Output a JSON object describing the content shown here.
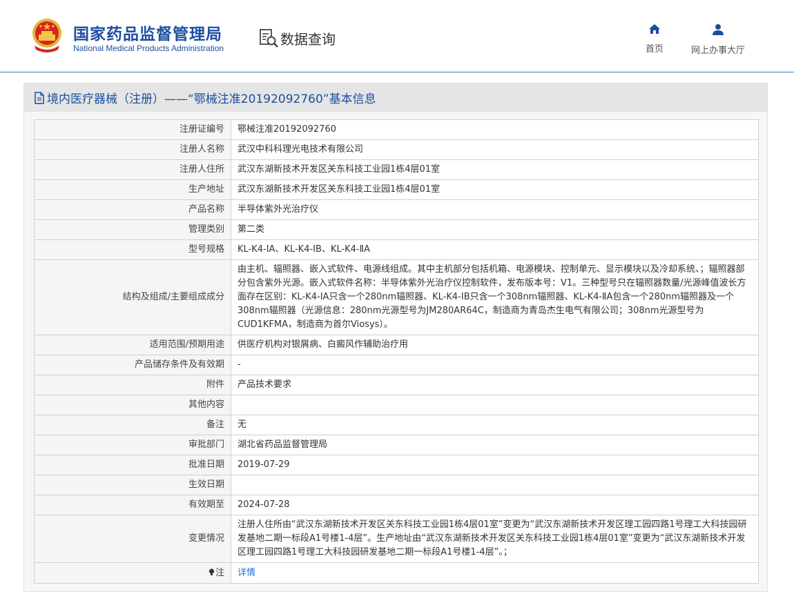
{
  "header": {
    "brand_cn": "国家药品监督管理局",
    "brand_en": "National Medical Products Administration",
    "module_title": "数据查询",
    "nav": [
      {
        "label": "首页",
        "icon": "home-icon"
      },
      {
        "label": "网上办事大厅",
        "icon": "user-icon"
      }
    ],
    "accent_color": "#1d4ea0"
  },
  "panel": {
    "title": "境内医疗器械（注册）——“鄂械注准20192092760”基本信息"
  },
  "rows": [
    {
      "label": "注册证编号",
      "value": "鄂械注准20192092760"
    },
    {
      "label": "注册人名称",
      "value": "武汉中科科理光电技术有限公司"
    },
    {
      "label": "注册人住所",
      "value": "武汉东湖新技术开发区关东科技工业园1栋4层01室"
    },
    {
      "label": "生产地址",
      "value": "武汉东湖新技术开发区关东科技工业园1栋4层01室"
    },
    {
      "label": "产品名称",
      "value": "半导体紫外光治疗仪"
    },
    {
      "label": "管理类别",
      "value": "第二类"
    },
    {
      "label": "型号规格",
      "value": "KL-K4-ⅠA、KL-K4-ⅠB、KL-K4-ⅡA"
    },
    {
      "label": "结构及组成/主要组成成分",
      "value": "由主机、辐照器、嵌入式软件、电源线组成。其中主机部分包括机箱、电源模块、控制单元、显示模块以及冷却系统、；辐照器部分包含紫外光源。嵌入式软件名称：半导体紫外光治疗仪控制软件，发布版本号：V1。三种型号只在辐照器数量/光源峰值波长方面存在区别：KL-K4-ⅠA只含一个280nm辐照器、KL-K4-ⅠB只含一个308nm辐照器、KL-K4-ⅡA包含一个280nm辐照器及一个308nm辐照器（光源信息：280nm光源型号为JM280AR64C，制造商为青岛杰生电气有限公司；308nm光源型号为CUD1KFMA，制造商为首尔Viosys）。"
    },
    {
      "label": "适用范围/预期用途",
      "value": "供医疗机构对银屑病、白癜风作辅助治疗用"
    },
    {
      "label": "产品储存条件及有效期",
      "value": "-"
    },
    {
      "label": "附件",
      "value": "产品技术要求"
    },
    {
      "label": "其他内容",
      "value": ""
    },
    {
      "label": "备注",
      "value": "无"
    },
    {
      "label": "审批部门",
      "value": "湖北省药品监督管理局"
    },
    {
      "label": "批准日期",
      "value": "2019-07-29"
    },
    {
      "label": "生效日期",
      "value": ""
    },
    {
      "label": "有效期至",
      "value": "2024-07-28"
    },
    {
      "label": "变更情况",
      "value": "注册人住所由“武汉东湖新技术开发区关东科技工业园1栋4层01室”变更为“武汉东湖新技术开发区理工园四路1号理工大科技园研发基地二期一标段A1号楼1-4层”。生产地址由“武汉东湖新技术开发区关东科技工业园1栋4层01室”变更为“武汉东湖新技术开发区理工园四路1号理工大科技园研发基地二期一标段A1号楼1-4层”。；"
    }
  ],
  "note": {
    "label": "注",
    "icon": "lightbulb-icon",
    "link": "详情"
  }
}
